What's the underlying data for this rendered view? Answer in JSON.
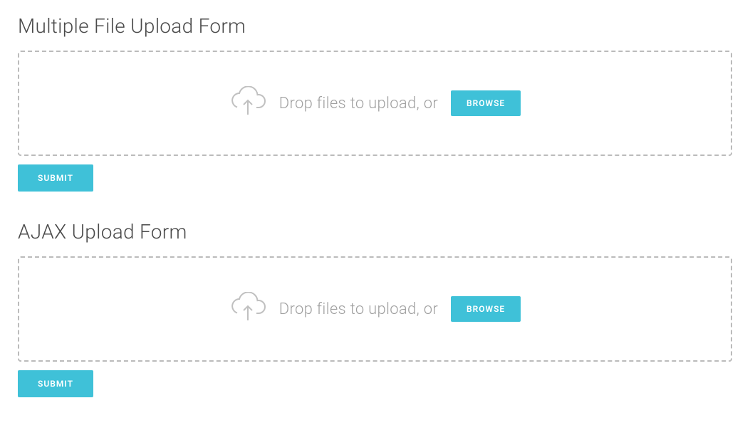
{
  "forms": {
    "multiple": {
      "title": "Multiple File Upload Form",
      "dropzone_text": "Drop files to upload, or",
      "browse_label": "BROWSE",
      "submit_label": "SUBMIT"
    },
    "ajax": {
      "title": "AJAX Upload Form",
      "dropzone_text": "Drop files to upload, or",
      "browse_label": "BROWSE",
      "submit_label": "SUBMIT"
    }
  }
}
